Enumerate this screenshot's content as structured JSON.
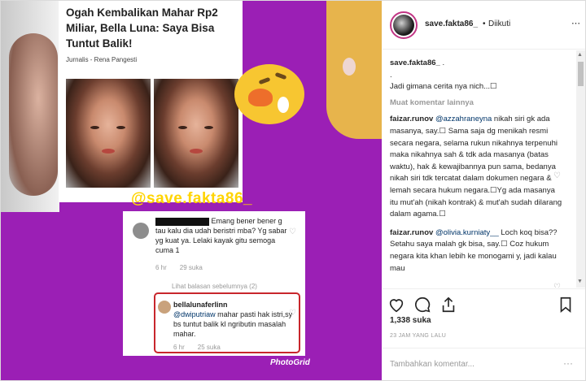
{
  "article": {
    "title": "Ogah Kembalikan Mahar Rp2 Miliar, Bella Luna: Saya Bisa Tuntut Balik!",
    "author": "Jurnalis - Rena Pangesti"
  },
  "collage_watermark": "@save.fakta86_",
  "photogrid_label": "PhotoGrid",
  "embedded_comments": {
    "first": {
      "text": "Emang bener bener g tau kalu dia udah beristri mba? Yg sabar yg kuat ya. Lelaki kayak gitu semoga cuma 1",
      "time": "6 hr",
      "likes": "29 suka"
    },
    "view_previous": "Lihat balasan sebelumnya (2)",
    "reply": {
      "user": "bellalunaferlinn",
      "mention": "@dwiputriaw",
      "text": " mahar pasti hak istri,sy bs tuntut balik kl ngributin masalah mahar.",
      "time": "6 hr",
      "likes": "25 suka"
    }
  },
  "header": {
    "username": "save.fakta86_",
    "separator": "•",
    "follow_status": "Diikuti",
    "more_icon": "ellipsis-icon"
  },
  "caption": {
    "user": "save.fakta86_",
    "text": " .",
    "line2": ".",
    "line3": "Jadi gimana cerita nya nich...☐"
  },
  "load_more": "Muat komentar lainnya",
  "comments": [
    {
      "user": "faizar.runov",
      "mention": "@azzahraneyna",
      "text": " nikah siri gk ada masanya, say.☐ Sama saja dg menikah resmi secara negara, selama rukun nikahnya terpenuhi maka nikahnya sah & tdk ada masanya (batas waktu), hak & kewajibannya pun sama, bedanya nikah siri tdk tercatat dalam dokumen negara & lemah secara hukum negara.☐Yg ada masanya itu mut'ah (nikah kontrak) & mut'ah sudah dilarang dalam agama.☐"
    },
    {
      "user": "faizar.runov",
      "mention": "@olivia.kurniaty__",
      "text": " Loch koq bisa?? Setahu saya malah gk bisa, say.☐ Coz hukum negara kita khan lebih ke monogami y, jadi kalau mau"
    }
  ],
  "likes": "1,338 suka",
  "timestamp": "23 JAM YANG LALU",
  "add_comment_placeholder": "Tambahkan komentar...",
  "add_comment_more": "···",
  "icons": {
    "like": "heart-icon",
    "comment": "comment-icon",
    "share": "share-icon",
    "save": "bookmark-icon"
  },
  "colors": {
    "collage_bg": "#9b1fb5",
    "watermark": "#ffd400",
    "highlight_box": "#c8262c",
    "link": "#003569"
  }
}
